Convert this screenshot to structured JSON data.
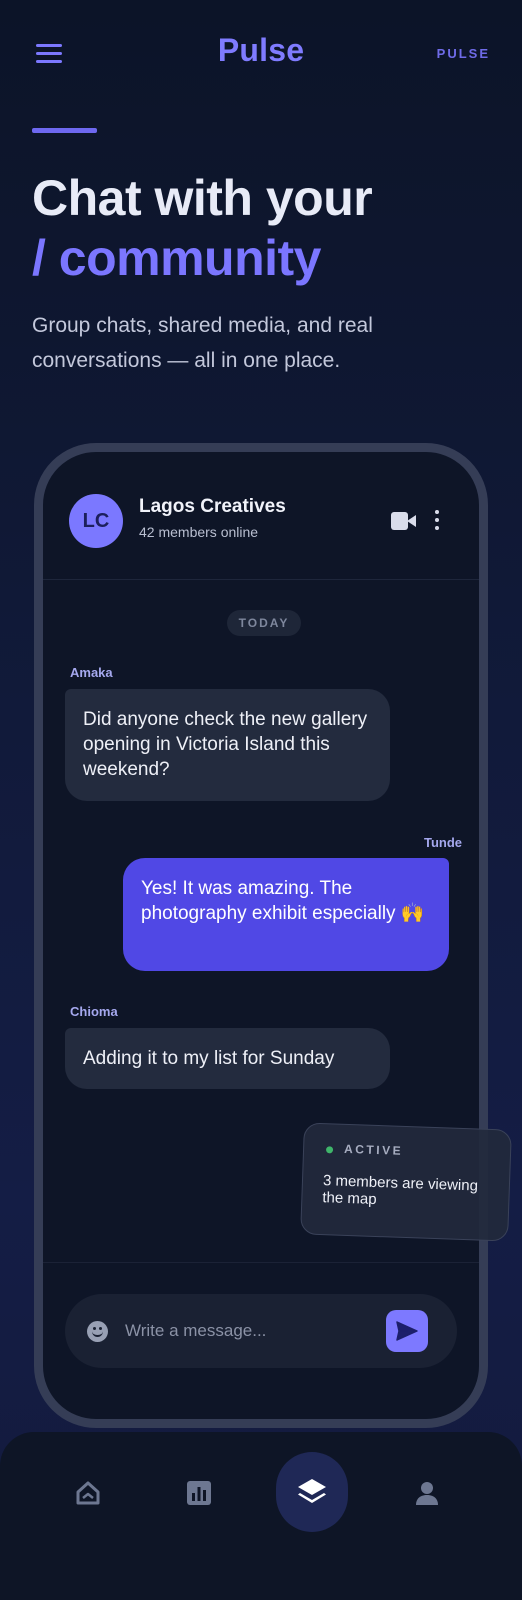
{
  "header": {
    "brand": "Pulse",
    "brand_right": "PULSE"
  },
  "hero": {
    "title_line1": "Chat with your",
    "title_line2": "/ community",
    "subtitle": "Group chats, shared media, and real conversations — all in one place."
  },
  "chat": {
    "group": {
      "initials": "LC",
      "name": "Lagos Creatives",
      "status": "42 members online"
    },
    "day_label": "TODAY",
    "messages": [
      {
        "sender": "Amaka",
        "text": "Did anyone check the new gallery opening in Victoria Island this weekend?",
        "direction": "incoming"
      },
      {
        "sender": "Tunde",
        "text": "Yes! It was amazing. The photography exhibit especially 🙌",
        "direction": "outgoing"
      },
      {
        "sender": "Chioma",
        "text": "Adding it to my list for Sunday",
        "direction": "incoming"
      }
    ],
    "composer": {
      "placeholder": "Write a message..."
    }
  },
  "active_card": {
    "label": "ACTIVE",
    "text": "3 members are viewing the map"
  },
  "bottom_nav": {
    "items": [
      "home-icon",
      "chart-icon",
      "layers-icon",
      "person-icon"
    ],
    "active": "layers-icon"
  },
  "colors": {
    "accent": "#7b76ff",
    "outgoing_bubble": "#5048e5",
    "incoming_bubble": "#232b3e",
    "active_dot": "#3fb56a"
  }
}
